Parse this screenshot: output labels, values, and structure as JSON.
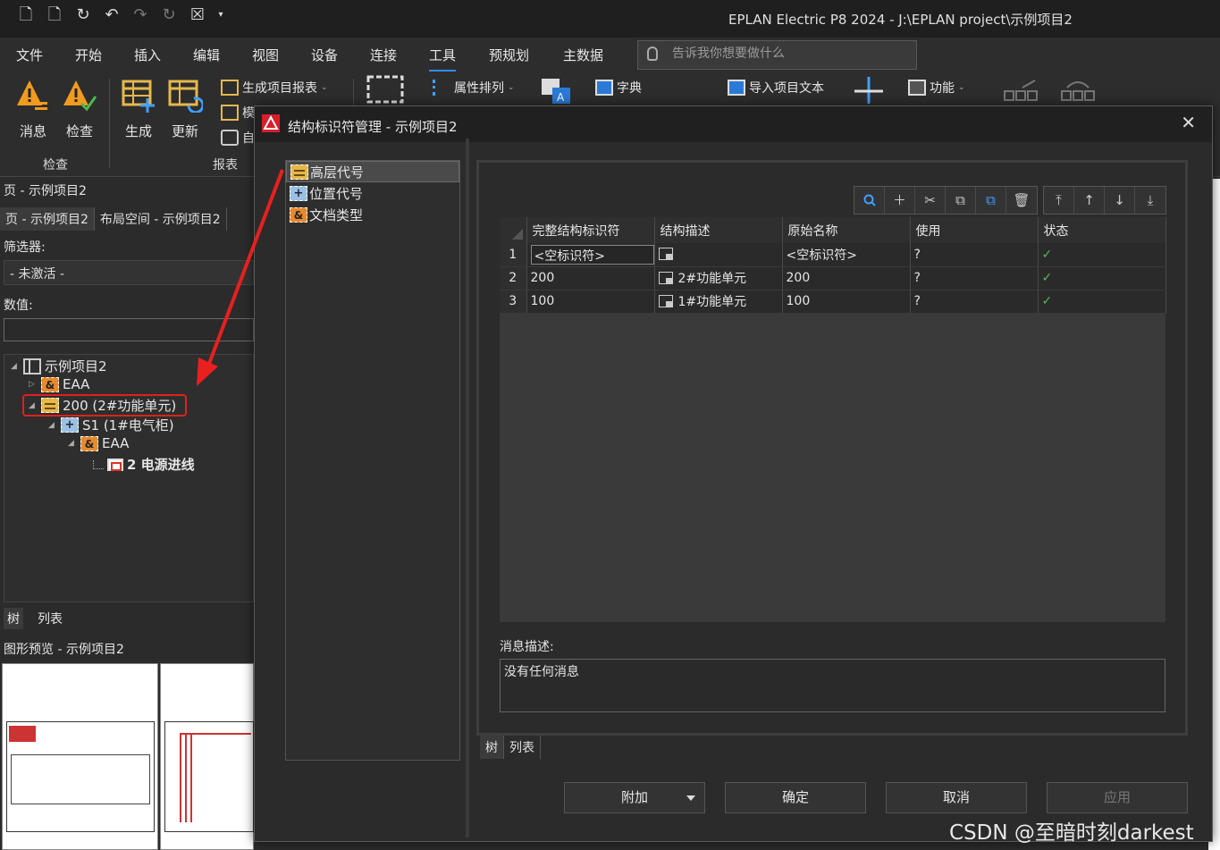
{
  "app": {
    "title": "EPLAN Electric P8 2024 - J:\\EPLAN project\\示例项目2"
  },
  "menu": {
    "items": [
      "文件",
      "开始",
      "插入",
      "编辑",
      "视图",
      "设备",
      "连接",
      "工具",
      "预规划",
      "主数据"
    ],
    "active": "工具",
    "search_placeholder": "告诉我你想要做什么"
  },
  "ribbon": {
    "messages": "消息",
    "check": "检查",
    "generate": "生成",
    "update": "更新",
    "generate_reports": "生成项目报表",
    "small2": "模",
    "small3": "自",
    "group_check": "检查",
    "group_reports": "报表",
    "property_sort": "属性排列",
    "dictionary": "字典",
    "import_text": "导入项目文本",
    "function": "功能"
  },
  "page_panel": {
    "title": "页 - 示例项目2",
    "tabs": [
      "页 - 示例项目2",
      "布局空间 - 示例项目2"
    ],
    "filter_label": "筛选器:",
    "filter_value": "- 未激活 -",
    "value_label": "数值:",
    "tree": {
      "project": "示例项目2",
      "eaa1": "EAA",
      "hl": "200 (2#功能单元)",
      "s1": "S1 (1#电气柜)",
      "eaa2": "EAA",
      "page": "2 电源进线"
    },
    "bottom_tabs": [
      "树",
      "列表"
    ],
    "preview_title": "图形预览 - 示例项目2"
  },
  "dialog": {
    "title": "结构标识符管理 - 示例项目2",
    "structures": [
      "高层代号",
      "位置代号",
      "文档类型"
    ],
    "grid": {
      "headers": [
        "完整结构标识符",
        "结构描述",
        "原始名称",
        "使用",
        "状态"
      ],
      "rows": [
        {
          "n": "1",
          "id": "<空标识符>",
          "desc": "",
          "orig": "<空标识符>",
          "use": "?",
          "status": "✓"
        },
        {
          "n": "2",
          "id": "200",
          "desc": "2#功能单元",
          "orig": "200",
          "use": "?",
          "status": "✓"
        },
        {
          "n": "3",
          "id": "100",
          "desc": "1#功能单元",
          "orig": "100",
          "use": "?",
          "status": "✓"
        }
      ]
    },
    "message_label": "消息描述:",
    "message_text": "没有任何消息",
    "tabs": [
      "树",
      "列表"
    ],
    "buttons": {
      "attach": "附加",
      "ok": "确定",
      "cancel": "取消",
      "apply": "应用"
    }
  },
  "watermark": "CSDN @至暗时刻darkest"
}
